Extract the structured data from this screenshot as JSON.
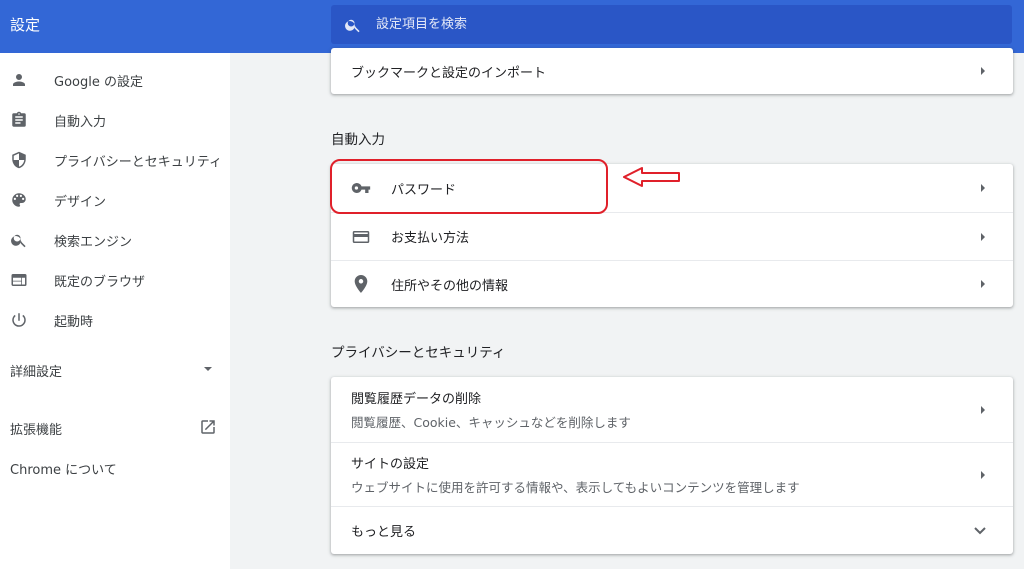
{
  "header": {
    "title": "設定",
    "search": {
      "placeholder": "設定項目を検索",
      "value": ""
    }
  },
  "sidebar": {
    "items": [
      {
        "label": "Google の設定",
        "icon": "person-icon"
      },
      {
        "label": "自動入力",
        "icon": "clipboard-icon"
      },
      {
        "label": "プライバシーとセキュリティ",
        "icon": "shield-icon"
      },
      {
        "label": "デザイン",
        "icon": "palette-icon"
      },
      {
        "label": "検索エンジン",
        "icon": "search-icon"
      },
      {
        "label": "既定のブラウザ",
        "icon": "browser-icon"
      },
      {
        "label": "起動時",
        "icon": "power-icon"
      }
    ],
    "advanced_label": "詳細設定",
    "extensions_label": "拡張機能",
    "about_label": "Chrome について"
  },
  "main": {
    "import_card": {
      "label": "ブックマークと設定のインポート"
    },
    "autofill": {
      "title": "自動入力",
      "rows": [
        {
          "label": "パスワード",
          "icon": "key-icon"
        },
        {
          "label": "お支払い方法",
          "icon": "credit-card-icon"
        },
        {
          "label": "住所やその他の情報",
          "icon": "location-pin-icon"
        }
      ]
    },
    "privacy": {
      "title": "プライバシーとセキュリティ",
      "rows": [
        {
          "label": "閲覧履歴データの削除",
          "sub": "閲覧履歴、Cookie、キャッシュなどを削除します"
        },
        {
          "label": "サイトの設定",
          "sub": "ウェブサイトに使用を許可する情報や、表示してもよいコンテンツを管理します"
        }
      ],
      "more_label": "もっと見る"
    }
  },
  "colors": {
    "header_blue": "#3367d6",
    "search_blue": "#2a56c6",
    "annotation_red": "#e0202a",
    "icon_gray": "#5f6368"
  }
}
